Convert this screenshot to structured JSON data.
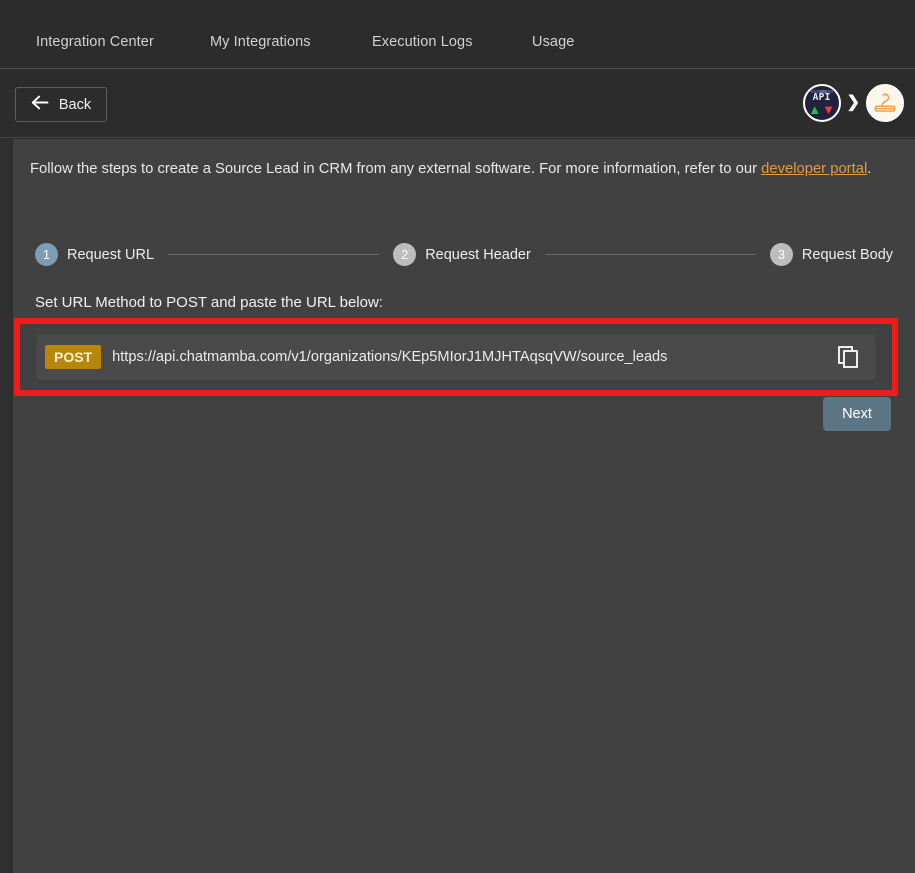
{
  "topnav": {
    "tabs": [
      {
        "label": "Integration Center"
      },
      {
        "label": "My Integrations"
      },
      {
        "label": "Execution Logs"
      },
      {
        "label": "Usage"
      }
    ]
  },
  "subheader": {
    "back_label": "Back",
    "back_arrow_icon": "arrow-left-icon",
    "api_badge_text": "API",
    "api_up_arrow": "▲",
    "api_down_arrow": "▼",
    "chevron": "❯",
    "logo_icon": "mamba-snake-logo"
  },
  "content": {
    "intro_before": "Follow the steps to create a Source Lead in CRM from any external software. For more information, refer to our ",
    "intro_link": "developer portal",
    "intro_after": ".",
    "instruction": "Set URL Method to POST and paste the URL below:",
    "steps": [
      {
        "number": "1",
        "label": "Request URL",
        "state": "active"
      },
      {
        "number": "2",
        "label": "Request Header",
        "state": "idle"
      },
      {
        "number": "3",
        "label": "Request Body",
        "state": "idle"
      }
    ],
    "url_row": {
      "method": "POST",
      "url": "https://api.chatmamba.com/v1/organizations/KEp5MIorJ1MJHTAqsqVW/source_leads",
      "copy_icon": "copy-icon"
    },
    "next_label": "Next"
  },
  "colors": {
    "accent_link": "#e79a3c",
    "method_badge": "#b8860b",
    "annotation_red": "#f01b1b",
    "step_active": "#7d9db3",
    "step_idle": "#bdbdbd",
    "next_button": "#5b7585"
  }
}
